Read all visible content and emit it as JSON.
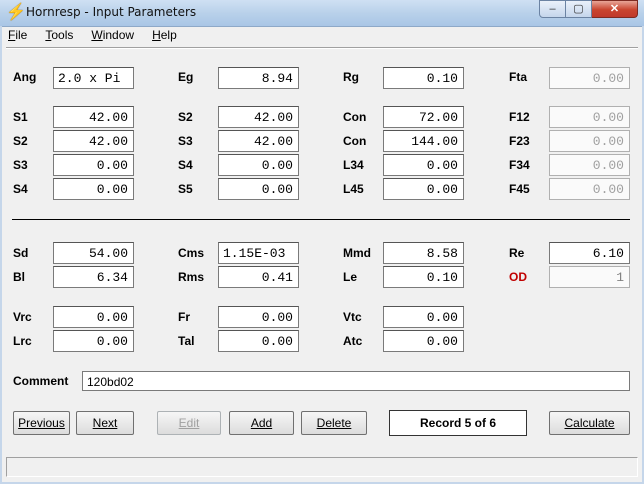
{
  "window": {
    "title": "Hornresp - Input Parameters",
    "icon": "lightning-icon",
    "controls": {
      "minimize": "–",
      "maximize": "▢",
      "close": "✕"
    }
  },
  "menu": [
    {
      "label_u": "F",
      "label_rest": "ile"
    },
    {
      "label_u": "T",
      "label_rest": "ools"
    },
    {
      "label_u": "W",
      "label_rest": "indow"
    },
    {
      "label_u": "H",
      "label_rest": "elp"
    }
  ],
  "col1": {
    "ang": {
      "label": "Ang",
      "value": "2.0 x Pi"
    },
    "s1": {
      "label": "S1",
      "value": "42.00"
    },
    "s2": {
      "label": "S2",
      "value": "42.00"
    },
    "s3": {
      "label": "S3",
      "value": "0.00"
    },
    "s4": {
      "label": "S4",
      "value": "0.00"
    }
  },
  "col2": {
    "eg": {
      "label": "Eg",
      "value": "8.94"
    },
    "s2": {
      "label": "S2",
      "value": "42.00"
    },
    "s3": {
      "label": "S3",
      "value": "42.00"
    },
    "s4": {
      "label": "S4",
      "value": "0.00"
    },
    "s5": {
      "label": "S5",
      "value": "0.00"
    }
  },
  "col3": {
    "rg": {
      "label": "Rg",
      "value": "0.10"
    },
    "con1": {
      "label": "Con",
      "value": "72.00"
    },
    "con2": {
      "label": "Con",
      "value": "144.00"
    },
    "l34": {
      "label": "L34",
      "value": "0.00"
    },
    "l45": {
      "label": "L45",
      "value": "0.00"
    }
  },
  "col4": {
    "fta": {
      "label": "Fta",
      "value": "0.00"
    },
    "f12": {
      "label": "F12",
      "value": "0.00"
    },
    "f23": {
      "label": "F23",
      "value": "0.00"
    },
    "f34": {
      "label": "F34",
      "value": "0.00"
    },
    "f45": {
      "label": "F45",
      "value": "0.00"
    }
  },
  "driver": {
    "sd": {
      "label": "Sd",
      "value": "54.00"
    },
    "bl": {
      "label": "Bl",
      "value": "6.34"
    },
    "cms": {
      "label": "Cms",
      "value": "1.15E-03"
    },
    "rms": {
      "label": "Rms",
      "value": "0.41"
    },
    "mmd": {
      "label": "Mmd",
      "value": "8.58"
    },
    "le": {
      "label": "Le",
      "value": "0.10"
    },
    "re": {
      "label": "Re",
      "value": "6.10"
    },
    "od": {
      "label": "OD",
      "value": "1"
    }
  },
  "chamber": {
    "vrc": {
      "label": "Vrc",
      "value": "0.00"
    },
    "lrc": {
      "label": "Lrc",
      "value": "0.00"
    },
    "fr": {
      "label": "Fr",
      "value": "0.00"
    },
    "tal": {
      "label": "Tal",
      "value": "0.00"
    },
    "vtc": {
      "label": "Vtc",
      "value": "0.00"
    },
    "atc": {
      "label": "Atc",
      "value": "0.00"
    }
  },
  "comment": {
    "label": "Comment",
    "value": "120bd02"
  },
  "buttons": {
    "previous": "Previous",
    "next": "Next",
    "edit": "Edit",
    "add": "Add",
    "delete": "Delete",
    "record": "Record 5 of 6",
    "calculate": "Calculate"
  },
  "colors": {
    "od_label": "#c00000",
    "disabled_text": "#a0a0a0"
  }
}
